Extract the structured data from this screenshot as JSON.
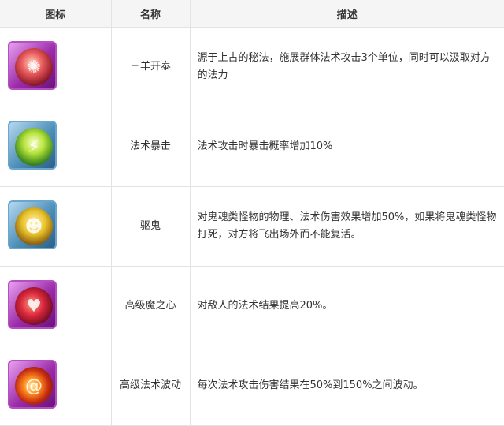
{
  "table": {
    "headers": {
      "icon": "图标",
      "name": "名称",
      "description": "描述"
    },
    "rows": [
      {
        "icon": "ram-swarm-skill-icon",
        "name": "三羊开泰",
        "description": "源于上古的秘法，施展群体法术攻击3个单位，同时可以汲取对方的法力"
      },
      {
        "icon": "lightning-burst-skill-icon",
        "name": "法术暴击",
        "description": "法术攻击时暴击概率增加10%"
      },
      {
        "icon": "ghost-face-skill-icon",
        "name": "驱鬼",
        "description": "对鬼魂类怪物的物理、法术伤害效果增加50%，如果将鬼魂类怪物打死，对方将飞出场外而不能复活。"
      },
      {
        "icon": "demon-heart-skill-icon",
        "name": "高级魔之心",
        "description": "对敌人的法术结果提高20%。"
      },
      {
        "icon": "fire-vortex-skill-icon",
        "name": "高级法术波动",
        "description": "每次法术攻击伤害结果在50%到150%之间波动。"
      }
    ]
  },
  "colors": {
    "header_bg": "#f5f5f5",
    "border": "#e3e3e3",
    "text": "#333333",
    "purple_frame": "#9b2ca8",
    "blue_frame": "#4d8fb8"
  }
}
